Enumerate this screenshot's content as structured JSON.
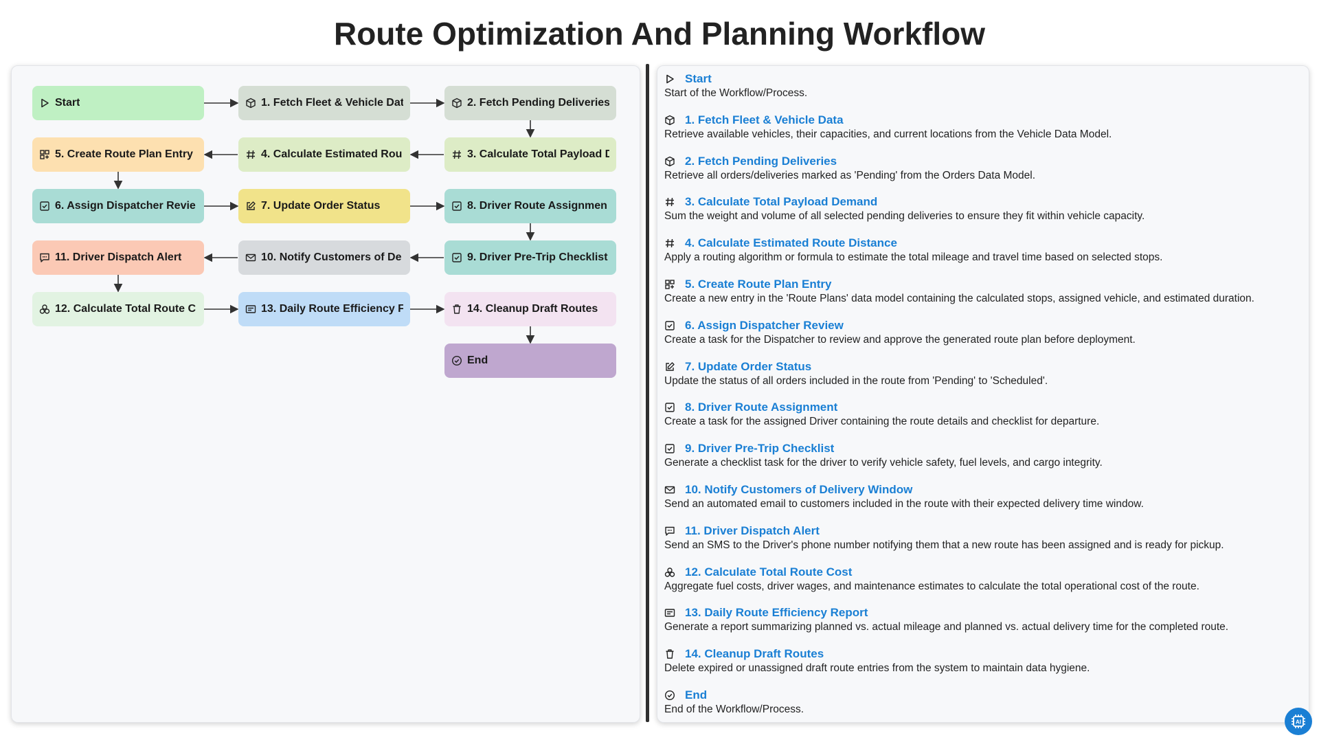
{
  "title": "Route Optimization And Planning Workflow",
  "colors": {
    "link": "#1a7fd4",
    "start": "#bff0c3",
    "fetch_fleet": "#d5ded4",
    "fetch_pending": "#d5ded4",
    "payload": "#ddecc6",
    "distance": "#ddecc6",
    "plan_entry": "#fde0b0",
    "dispatcher": "#a9dcd5",
    "order_status": "#f1e38a",
    "route_assign": "#a9dcd5",
    "pretrip": "#a9dcd5",
    "notify": "#d7dadd",
    "alert": "#fbc9b5",
    "cost": "#e2f3e2",
    "report": "#bfdcf7",
    "cleanup": "#f3e3f1",
    "end": "#bfa7cf"
  },
  "nodes": [
    {
      "id": "start",
      "label": "Start",
      "icon": "play-icon"
    },
    {
      "id": "n1",
      "label": "1. Fetch Fleet & Vehicle Dat",
      "icon": "cube-icon"
    },
    {
      "id": "n2",
      "label": "2. Fetch Pending Deliveries",
      "icon": "cube-icon"
    },
    {
      "id": "n3",
      "label": "3. Calculate Total Payload D",
      "icon": "hash-icon"
    },
    {
      "id": "n4",
      "label": "4. Calculate Estimated Rou",
      "icon": "hash-icon"
    },
    {
      "id": "n5",
      "label": "5. Create Route Plan Entry",
      "icon": "grid-plus-icon"
    },
    {
      "id": "n6",
      "label": "6. Assign Dispatcher Revie",
      "icon": "checkbox-icon"
    },
    {
      "id": "n7",
      "label": "7. Update Order Status",
      "icon": "edit-icon"
    },
    {
      "id": "n8",
      "label": "8. Driver Route Assignmen",
      "icon": "checkbox-icon"
    },
    {
      "id": "n9",
      "label": "9. Driver Pre-Trip Checklist",
      "icon": "checkbox-icon"
    },
    {
      "id": "n10",
      "label": "10. Notify Customers of De",
      "icon": "mail-icon"
    },
    {
      "id": "n11",
      "label": "11. Driver Dispatch Alert",
      "icon": "sms-icon"
    },
    {
      "id": "n12",
      "label": "12. Calculate Total Route C",
      "icon": "coins-icon"
    },
    {
      "id": "n13",
      "label": "13. Daily Route Efficiency F",
      "icon": "report-icon"
    },
    {
      "id": "n14",
      "label": "14. Cleanup Draft Routes",
      "icon": "trash-icon"
    },
    {
      "id": "end",
      "label": "End",
      "icon": "check-circle-icon"
    }
  ],
  "descriptions": [
    {
      "name": "Start",
      "icon": "play-icon",
      "text": "Start of the Workflow/Process."
    },
    {
      "name": "1. Fetch Fleet & Vehicle Data",
      "icon": "cube-icon",
      "text": "Retrieve available vehicles, their capacities, and current locations from the Vehicle Data Model."
    },
    {
      "name": "2. Fetch Pending Deliveries",
      "icon": "cube-icon",
      "text": "Retrieve all orders/deliveries marked as 'Pending' from the Orders Data Model."
    },
    {
      "name": "3. Calculate Total Payload Demand",
      "icon": "hash-icon",
      "text": "Sum the weight and volume of all selected pending deliveries to ensure they fit within vehicle capacity."
    },
    {
      "name": "4. Calculate Estimated Route Distance",
      "icon": "hash-icon",
      "text": "Apply a routing algorithm or formula to estimate the total mileage and travel time based on selected stops."
    },
    {
      "name": "5. Create Route Plan Entry",
      "icon": "grid-plus-icon",
      "text": "Create a new entry in the 'Route Plans' data model containing the calculated stops, assigned vehicle, and estimated duration."
    },
    {
      "name": "6. Assign Dispatcher Review",
      "icon": "checkbox-icon",
      "text": "Create a task for the Dispatcher to review and approve the generated route plan before deployment."
    },
    {
      "name": "7. Update Order Status",
      "icon": "edit-icon",
      "text": "Update the status of all orders included in the route from 'Pending' to 'Scheduled'."
    },
    {
      "name": "8. Driver Route Assignment",
      "icon": "checkbox-icon",
      "text": "Create a task for the assigned Driver containing the route details and checklist for departure."
    },
    {
      "name": "9. Driver Pre-Trip Checklist",
      "icon": "checkbox-icon",
      "text": "Generate a checklist task for the driver to verify vehicle safety, fuel levels, and cargo integrity."
    },
    {
      "name": "10. Notify Customers of Delivery Window",
      "icon": "mail-icon",
      "text": "Send an automated email to customers included in the route with their expected delivery time window."
    },
    {
      "name": "11. Driver Dispatch Alert",
      "icon": "sms-icon",
      "text": "Send an SMS to the Driver's phone number notifying them that a new route has been assigned and is ready for pickup."
    },
    {
      "name": "12. Calculate Total Route Cost",
      "icon": "coins-icon",
      "text": "Aggregate fuel costs, driver wages, and maintenance estimates to calculate the total operational cost of the route."
    },
    {
      "name": "13. Daily Route Efficiency Report",
      "icon": "report-icon",
      "text": "Generate a report summarizing planned vs. actual mileage and planned vs. actual delivery time for the completed route."
    },
    {
      "name": "14. Cleanup Draft Routes",
      "icon": "trash-icon",
      "text": "Delete expired or unassigned draft route entries from the system to maintain data hygiene."
    },
    {
      "name": "End",
      "icon": "check-circle-icon",
      "text": "End of the Workflow/Process."
    }
  ],
  "badge_icon": "ai-chip-icon"
}
